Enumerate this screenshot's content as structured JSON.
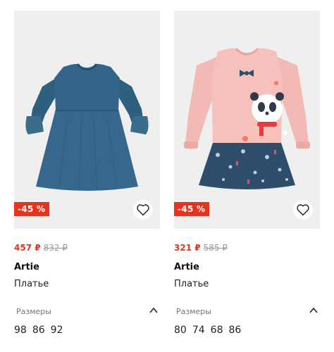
{
  "products": [
    {
      "discount": "-45 %",
      "price_new": "457 ₽",
      "price_old": "832 ₽",
      "brand": "Artie",
      "type": "Платье",
      "sizes_label": "Размеры",
      "sizes": [
        "98",
        "86",
        "92"
      ],
      "image": "blue-dress"
    },
    {
      "discount": "-45 %",
      "price_new": "321 ₽",
      "price_old": "585 ₽",
      "brand": "Artie",
      "type": "Платье",
      "sizes_label": "Размеры",
      "sizes": [
        "80",
        "74",
        "68",
        "86"
      ],
      "image": "pink-panda-dress"
    }
  ],
  "colors": {
    "discount_badge": "#e8321e",
    "price_new": "#e8321e",
    "price_old": "#9b9b9b"
  }
}
